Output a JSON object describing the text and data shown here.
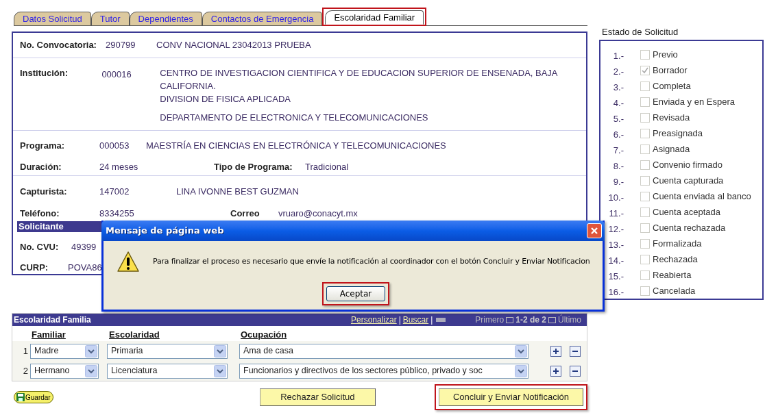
{
  "tabs": [
    {
      "label": "Datos Solicitud",
      "selected": false,
      "highlighted": false
    },
    {
      "label": "Tutor",
      "selected": false,
      "highlighted": false
    },
    {
      "label": "Dependientes",
      "selected": false,
      "highlighted": false
    },
    {
      "label": "Contactos de Emergencia",
      "selected": false,
      "highlighted": false
    },
    {
      "label": "Escolaridad Familiar",
      "selected": true,
      "highlighted": true
    }
  ],
  "application": {
    "convocatoria": {
      "label": "No. Convocatoria:",
      "code": "290799",
      "name": "CONV NACIONAL 23042013 PRUEBA"
    },
    "institucion": {
      "label": "Institución:",
      "code": "000016",
      "lines": [
        "CENTRO DE INVESTIGACION CIENTIFICA Y DE EDUCACION SUPERIOR DE ENSENADA, BAJA CALIFORNIA.",
        "DIVISION DE FISICA APLICADA",
        "DEPARTAMENTO DE ELECTRONICA Y TELECOMUNICACIONES"
      ]
    },
    "programa": {
      "label": "Programa:",
      "code": "000053",
      "name": "MAESTRÍA EN CIENCIAS EN ELECTRÓNICA Y TELECOMUNICACIONES"
    },
    "duracion": {
      "label": "Duración:",
      "value": "24 meses"
    },
    "tipo_programa": {
      "label": "Tipo de Programa:",
      "value": "Tradicional"
    },
    "capturista": {
      "label": "Capturista:",
      "code": "147002",
      "name": "LINA IVONNE BEST GUZMAN"
    },
    "telefono": {
      "label": "Teléfono:",
      "value": "8334255"
    },
    "correo": {
      "label": "Correo",
      "value": "vruaro@conacyt.mx"
    },
    "section_title": "Solicitante",
    "cvu": {
      "label": "No. CVU:",
      "value": "49399"
    },
    "curp": {
      "label": "CURP:",
      "value": "POVA86"
    }
  },
  "status_panel": {
    "title": "Estado de Solicitud",
    "items": [
      {
        "number": "1.-",
        "label": "Previo",
        "checked": false
      },
      {
        "number": "2.-",
        "label": "Borrador",
        "checked": true
      },
      {
        "number": "3.-",
        "label": "Completa",
        "checked": false
      },
      {
        "number": "4.-",
        "label": "Enviada y en Espera",
        "checked": false
      },
      {
        "number": "5.-",
        "label": "Revisada",
        "checked": false
      },
      {
        "number": "6.-",
        "label": "Preasignada",
        "checked": false
      },
      {
        "number": "7.-",
        "label": "Asignada",
        "checked": false
      },
      {
        "number": "8.-",
        "label": "Convenio firmado",
        "checked": false
      },
      {
        "number": "9.-",
        "label": "Cuenta capturada",
        "checked": false
      },
      {
        "number": "10.-",
        "label": "Cuenta enviada al banco",
        "checked": false
      },
      {
        "number": "11.-",
        "label": "Cuenta aceptada",
        "checked": false
      },
      {
        "number": "12.-",
        "label": "Cuenta rechazada",
        "checked": false
      },
      {
        "number": "13.-",
        "label": "Formalizada",
        "checked": false
      },
      {
        "number": "14.-",
        "label": "Rechazada",
        "checked": false
      },
      {
        "number": "15.-",
        "label": "Reabierta",
        "checked": false
      },
      {
        "number": "16.-",
        "label": "Cancelada",
        "checked": false
      }
    ]
  },
  "family_grid": {
    "title": "Escolaridad Familia",
    "links": [
      "Personalizar",
      "Buscar"
    ],
    "separator": "|",
    "nav": {
      "first": "Primero",
      "range": "1-2 de 2",
      "last": "Último"
    },
    "columns": [
      "Familiar",
      "Escolaridad",
      "Ocupación"
    ],
    "rows": [
      {
        "number": "1",
        "familiar": "Madre",
        "escolaridad": "Primaria",
        "ocupacion": "Ama de casa"
      },
      {
        "number": "2",
        "familiar": "Hermano",
        "escolaridad": "Licenciatura",
        "ocupacion": "Funcionarios y directivos de los sectores público, privado y soc"
      }
    ]
  },
  "actions": {
    "save": "Guardar",
    "reject": "Rechazar Solicitud",
    "conclude": {
      "label": "Concluir y Enviar Notificación",
      "highlighted": true
    }
  },
  "dialog": {
    "title": "Mensaje de página web",
    "message": "Para finalizar el proceso es necesario que envíe la notificación al coordinador con el botón Concluir y Enviar Notificacion",
    "button": {
      "label": "Aceptar",
      "highlighted": true
    }
  }
}
